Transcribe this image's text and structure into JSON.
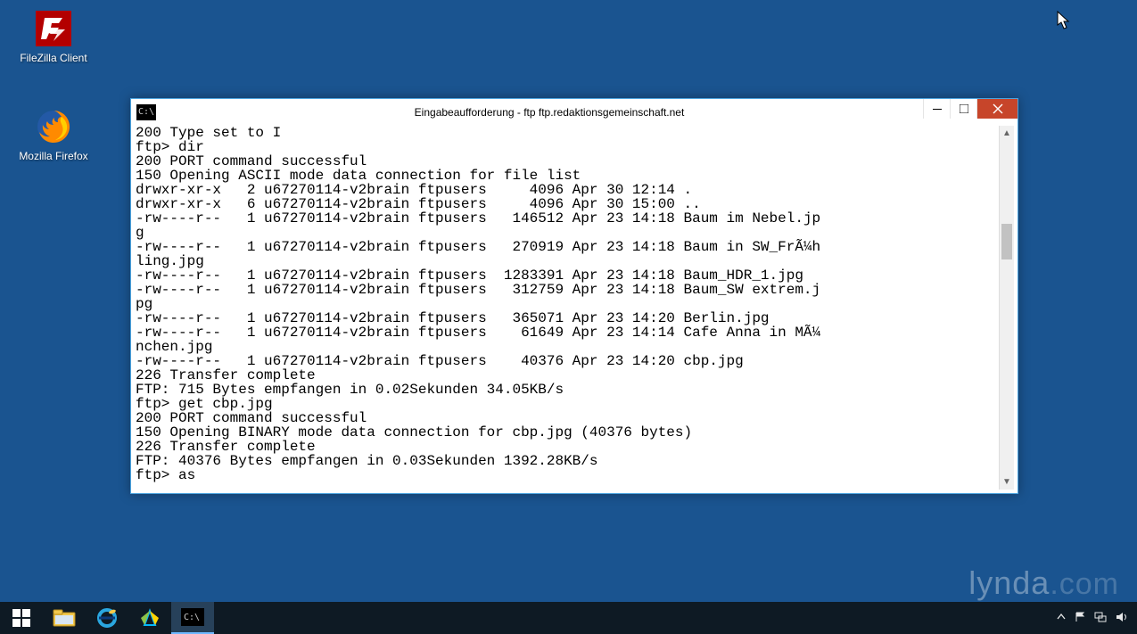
{
  "desktop_icons": {
    "filezilla": "FileZilla Client",
    "firefox": "Mozilla Firefox"
  },
  "window": {
    "title": "Eingabeaufforderung - ftp  ftp.redaktionsgemeinschaft.net"
  },
  "terminal_lines": [
    "200 Type set to I",
    "ftp> dir",
    "200 PORT command successful",
    "150 Opening ASCII mode data connection for file list",
    "drwxr-xr-x   2 u67270114-v2brain ftpusers     4096 Apr 30 12:14 .",
    "drwxr-xr-x   6 u67270114-v2brain ftpusers     4096 Apr 30 15:00 ..",
    "-rw----r--   1 u67270114-v2brain ftpusers   146512 Apr 23 14:18 Baum im Nebel.jp",
    "g",
    "-rw----r--   1 u67270114-v2brain ftpusers   270919 Apr 23 14:18 Baum in SW_FrÃ¼h",
    "ling.jpg",
    "-rw----r--   1 u67270114-v2brain ftpusers  1283391 Apr 23 14:18 Baum_HDR_1.jpg",
    "-rw----r--   1 u67270114-v2brain ftpusers   312759 Apr 23 14:18 Baum_SW extrem.j",
    "pg",
    "-rw----r--   1 u67270114-v2brain ftpusers   365071 Apr 23 14:20 Berlin.jpg",
    "-rw----r--   1 u67270114-v2brain ftpusers    61649 Apr 23 14:14 Cafe Anna in MÃ¼",
    "nchen.jpg",
    "-rw----r--   1 u67270114-v2brain ftpusers    40376 Apr 23 14:20 cbp.jpg",
    "226 Transfer complete",
    "FTP: 715 Bytes empfangen in 0.02Sekunden 34.05KB/s",
    "ftp> get cbp.jpg",
    "200 PORT command successful",
    "150 Opening BINARY mode data connection for cbp.jpg (40376 bytes)",
    "226 Transfer complete",
    "FTP: 40376 Bytes empfangen in 0.03Sekunden 1392.28KB/s",
    "ftp> as"
  ],
  "watermark": {
    "brand": "lynda",
    "suffix": ".com"
  }
}
